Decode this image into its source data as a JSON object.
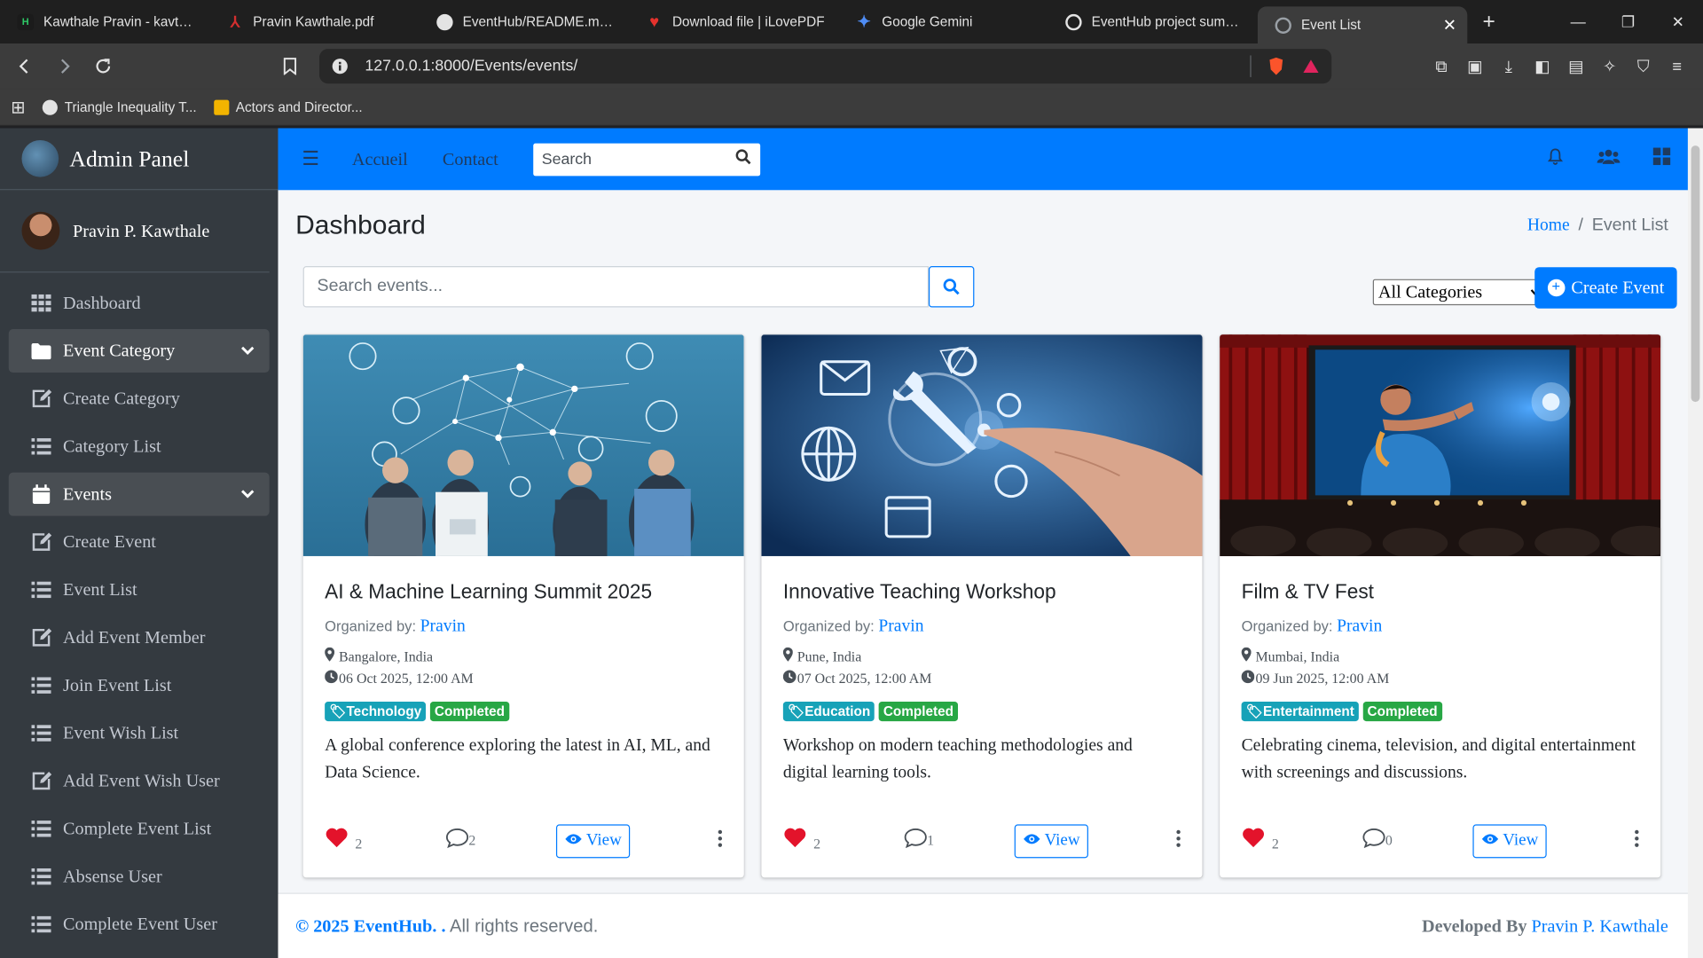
{
  "browser": {
    "tabs": [
      {
        "title": "Kawthale Pravin - kavthale",
        "fav_color": "#1b1b1b",
        "fav_text": "H",
        "icon": "hackerrank-icon"
      },
      {
        "title": "Pravin Kawthale.pdf",
        "fav_color": "#d32f2f",
        "fav_text": "A",
        "icon": "pdf-icon"
      },
      {
        "title": "EventHub/README.md at",
        "fav_color": "#e3e3e3",
        "fav_text": "",
        "icon": "github-icon"
      },
      {
        "title": "Download file | iLovePDF",
        "fav_color": "#e5322d",
        "fav_text": "",
        "icon": "ilovepdf-icon"
      },
      {
        "title": "Google Gemini",
        "fav_color": "#4f8df5",
        "fav_text": "",
        "icon": "gemini-icon"
      },
      {
        "title": "EventHub project summar",
        "fav_color": "#e3e3e3",
        "fav_text": "",
        "icon": "chatgpt-icon"
      },
      {
        "title": "Event List",
        "fav_color": "#9aa0a6",
        "fav_text": "",
        "icon": "globe-icon",
        "active": true
      }
    ],
    "url": "127.0.0.1:8000/Events/events/",
    "bookmarks": [
      {
        "label": "Triangle Inequality T..."
      },
      {
        "label": "Actors and Director..."
      }
    ]
  },
  "sidebar": {
    "brand": "Admin Panel",
    "user": "Pravin P. Kawthale",
    "items": [
      {
        "label": "Dashboard",
        "icon": "th-icon"
      },
      {
        "label": "Event Category",
        "icon": "folder-icon",
        "open": true
      },
      {
        "label": "Create Category",
        "icon": "edit-icon"
      },
      {
        "label": "Category List",
        "icon": "list-icon"
      },
      {
        "label": "Events",
        "icon": "calendar-icon",
        "open": true
      },
      {
        "label": "Create Event",
        "icon": "edit-icon"
      },
      {
        "label": "Event List",
        "icon": "list-icon"
      },
      {
        "label": "Add Event Member",
        "icon": "edit-icon"
      },
      {
        "label": "Join Event List",
        "icon": "list-icon"
      },
      {
        "label": "Event Wish List",
        "icon": "list-icon"
      },
      {
        "label": "Add Event Wish User",
        "icon": "edit-icon"
      },
      {
        "label": "Complete Event List",
        "icon": "list-icon"
      },
      {
        "label": "Absense User",
        "icon": "list-icon"
      },
      {
        "label": "Complete Event User",
        "icon": "list-icon"
      }
    ]
  },
  "topnav": {
    "links": [
      "Accueil",
      "Contact"
    ],
    "search_placeholder": "Search"
  },
  "page": {
    "title": "Dashboard",
    "breadcrumb_home": "Home",
    "breadcrumb_current": "Event List",
    "event_search_placeholder": "Search events...",
    "category_select": "All Categories",
    "create_button": "Create Event"
  },
  "events": [
    {
      "title": "AI & Machine Learning Summit 2025",
      "org_label": "Organized by:",
      "organizer": "Pravin",
      "location": "Bangalore, India",
      "datetime": "06 Oct 2025, 12:00 AM",
      "category": "Technology",
      "status": "Completed",
      "description": "A global conference exploring the latest in AI, ML, and Data Science.",
      "likes": "2",
      "comments": "2",
      "view_label": "View"
    },
    {
      "title": "Innovative Teaching Workshop",
      "org_label": "Organized by:",
      "organizer": "Pravin",
      "location": "Pune, India",
      "datetime": "07 Oct 2025, 12:00 AM",
      "category": "Education",
      "status": "Completed",
      "description": "Workshop on modern teaching methodologies and digital learning tools.",
      "likes": "2",
      "comments": "1",
      "view_label": "View"
    },
    {
      "title": "Film & TV Fest",
      "org_label": "Organized by:",
      "organizer": "Pravin",
      "location": "Mumbai, India",
      "datetime": "09 Jun 2025, 12:00 AM",
      "category": "Entertainment",
      "status": "Completed",
      "description": "Celebrating cinema, television, and digital entertainment with screenings and discussions.",
      "likes": "2",
      "comments": "0",
      "view_label": "View"
    }
  ],
  "footer": {
    "copyright": "© 2025 EventHub. .",
    "rights": "All rights reserved.",
    "dev_label": "Developed By",
    "developer": "Pravin P. Kawthale"
  },
  "colors": {
    "primary": "#007bff",
    "sidebar": "#343a40",
    "info": "#17a2b8",
    "success": "#28a745",
    "heart": "#e3132b"
  }
}
